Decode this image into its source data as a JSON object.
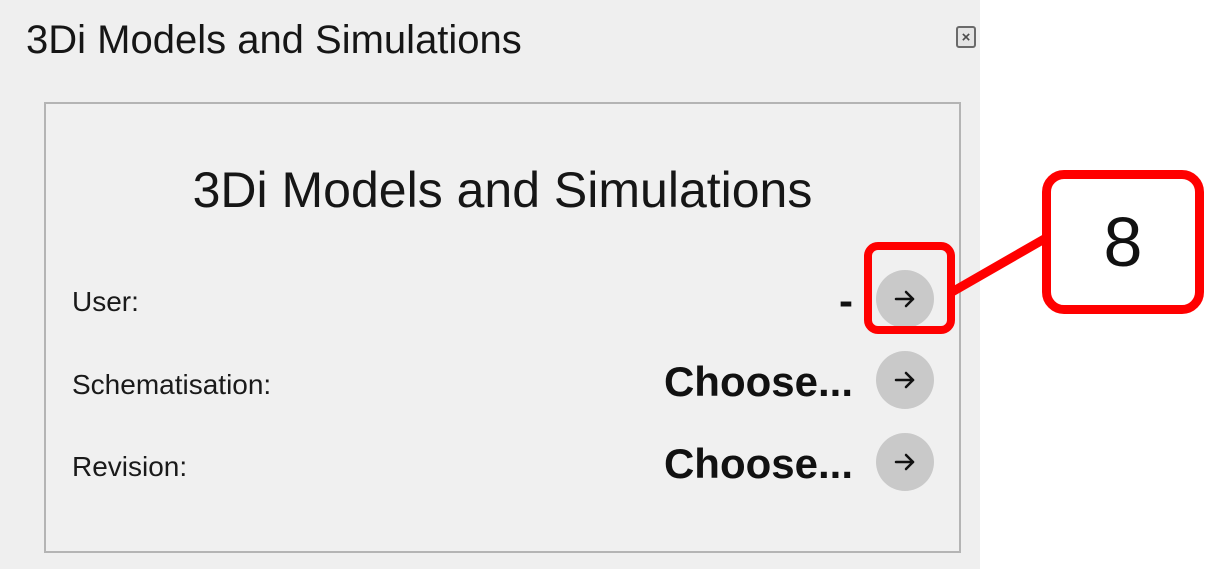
{
  "dock": {
    "title": "3Di Models and Simulations",
    "close_icon": "close-icon"
  },
  "panel": {
    "heading": "3Di Models and Simulations",
    "rows": [
      {
        "label": "User:",
        "value": "-",
        "button_icon": "arrow-right-icon"
      },
      {
        "label": "Schematisation:",
        "value": "Choose...",
        "button_icon": "arrow-right-icon"
      },
      {
        "label": "Revision:",
        "value": "Choose...",
        "button_icon": "arrow-right-icon"
      }
    ]
  },
  "annotation": {
    "number": "8",
    "color": "#ff0000"
  }
}
